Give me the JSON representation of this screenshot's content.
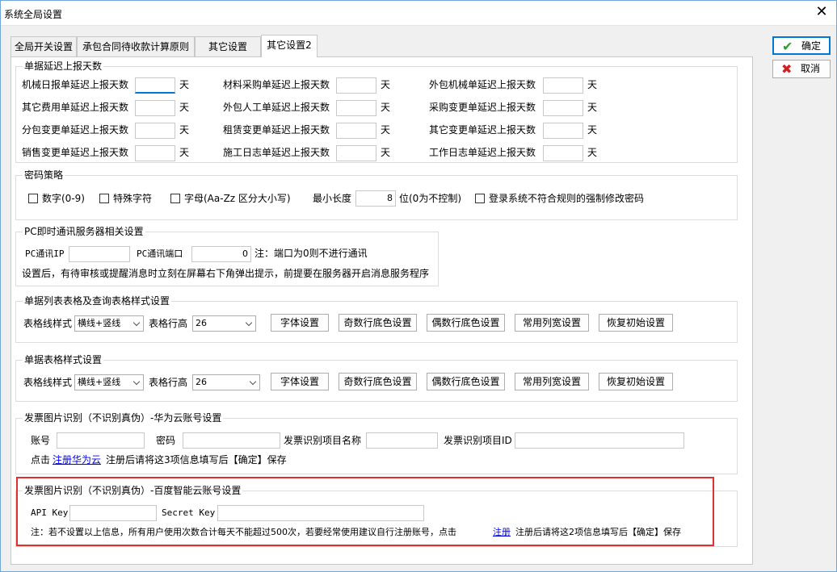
{
  "window": {
    "title": "系统全局设置",
    "close_glyph": "✕"
  },
  "tabs": [
    {
      "label": "全局开关设置"
    },
    {
      "label": "承包合同待收款计算原则"
    },
    {
      "label": "其它设置"
    },
    {
      "label": "其它设置2"
    }
  ],
  "side_buttons": {
    "ok": {
      "label": "确定",
      "icon": "check-icon"
    },
    "cancel": {
      "label": "取消",
      "icon": "x-icon"
    }
  },
  "delay": {
    "title": "单据延迟上报天数",
    "unit": "天",
    "items": [
      {
        "label": "机械日报单延迟上报天数",
        "value": ""
      },
      {
        "label": "材料采购单延迟上报天数",
        "value": ""
      },
      {
        "label": "外包机械单延迟上报天数",
        "value": ""
      },
      {
        "label": "其它费用单延迟上报天数",
        "value": ""
      },
      {
        "label": "外包人工单延迟上报天数",
        "value": ""
      },
      {
        "label": "采购变更单延迟上报天数",
        "value": ""
      },
      {
        "label": "分包变更单延迟上报天数",
        "value": ""
      },
      {
        "label": "租赁变更单延迟上报天数",
        "value": ""
      },
      {
        "label": "其它变更单延迟上报天数",
        "value": ""
      },
      {
        "label": "销售变更单延迟上报天数",
        "value": ""
      },
      {
        "label": "施工日志单延迟上报天数",
        "value": ""
      },
      {
        "label": "工作日志单延迟上报天数",
        "value": ""
      }
    ]
  },
  "password": {
    "title": "密码策略",
    "digits": "数字(0-9)",
    "special": "特殊字符",
    "letters": "字母(Aa-Zz  区分大小写)",
    "min_len_label": "最小长度",
    "min_len_value": "8",
    "min_len_suffix": "位(0为不控制)",
    "force_change": "登录系统不符合规则的强制修改密码"
  },
  "pc_im": {
    "title": "PC即时通讯服务器相关设置",
    "ip_label": "PC通讯IP",
    "ip_value": "",
    "port_label": "PC通讯端口",
    "port_value": "0",
    "port_note": "注：端口为0则不进行通讯",
    "note": "设置后，有待审核或提醒消息时立刻在屏幕右下角弹出提示，前提要在服务器开启消息服务程序"
  },
  "list_style": {
    "title": "单据列表表格及查询表格样式设置",
    "line_label": "表格线样式",
    "line_value": "横线+竖线",
    "height_label": "表格行高",
    "height_value": "26",
    "btn_font": "字体设置",
    "btn_odd": "奇数行底色设置",
    "btn_even": "偶数行底色设置",
    "btn_width": "常用列宽设置",
    "btn_reset": "恢复初始设置"
  },
  "doc_style": {
    "title": "单据表格样式设置",
    "line_label": "表格线样式",
    "line_value": "横线+竖线",
    "height_label": "表格行高",
    "height_value": "26",
    "btn_font": "字体设置",
    "btn_odd": "奇数行底色设置",
    "btn_even": "偶数行底色设置",
    "btn_width": "常用列宽设置",
    "btn_reset": "恢复初始设置"
  },
  "huawei": {
    "title": "发票图片识别（不识别真伪）-华为云账号设置",
    "account_label": "账号",
    "account_value": "",
    "password_label": "密码",
    "password_value": "",
    "project_name_label": "发票识别项目名称",
    "project_name_value": "",
    "project_id_label": "发票识别项目ID",
    "project_id_value": "",
    "click_prefix": "点击",
    "link": "注册华为云",
    "click_suffix": "注册后请将这3项信息填写后【确定】保存"
  },
  "baidu": {
    "title": "发票图片识别（不识别真伪）-百度智能云账号设置",
    "api_key_label": "API Key",
    "api_key_value": "",
    "secret_key_label": "Secret Key",
    "secret_key_value": "",
    "note_prefix": "注：若不设置以上信息，所有用户使用次数合计每天不能超过500次，若要经常使用建议自行注册账号，点击",
    "link": "注册",
    "note_suffix": "注册后请将这2项信息填写后【确定】保存"
  },
  "colors": {
    "accent": "#0078d7",
    "highlight": "#e03030",
    "ok_icon": "#2e9e2e",
    "cancel_icon": "#d02020",
    "link": "#0000ee"
  }
}
